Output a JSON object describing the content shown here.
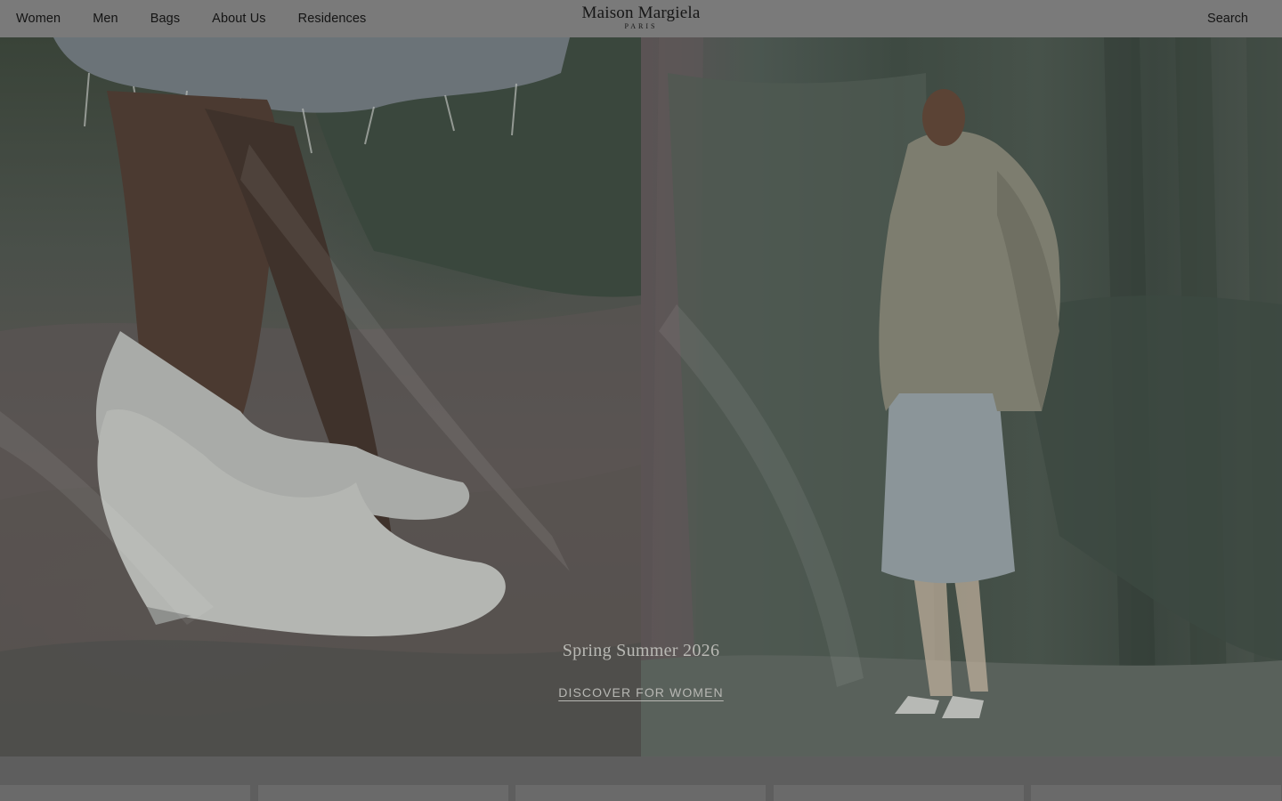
{
  "header": {
    "nav": [
      "Women",
      "Men",
      "Bags",
      "About Us",
      "Residences"
    ],
    "logo": {
      "brand": "Maison Margiela",
      "city": "PARIS"
    },
    "search_label": "Search"
  },
  "hero": {
    "season": "Spring Summer 2026",
    "cta": "DISCOVER FOR WOMEN",
    "left_image": "shoe-closeup-photo",
    "right_image": "model-trench-coat-photo"
  },
  "colors": {
    "header_bg": "#7a7a7a",
    "text_dark": "#141414",
    "overlay_text": "#b9b9b4",
    "page_bg": "#5e5e5e"
  }
}
